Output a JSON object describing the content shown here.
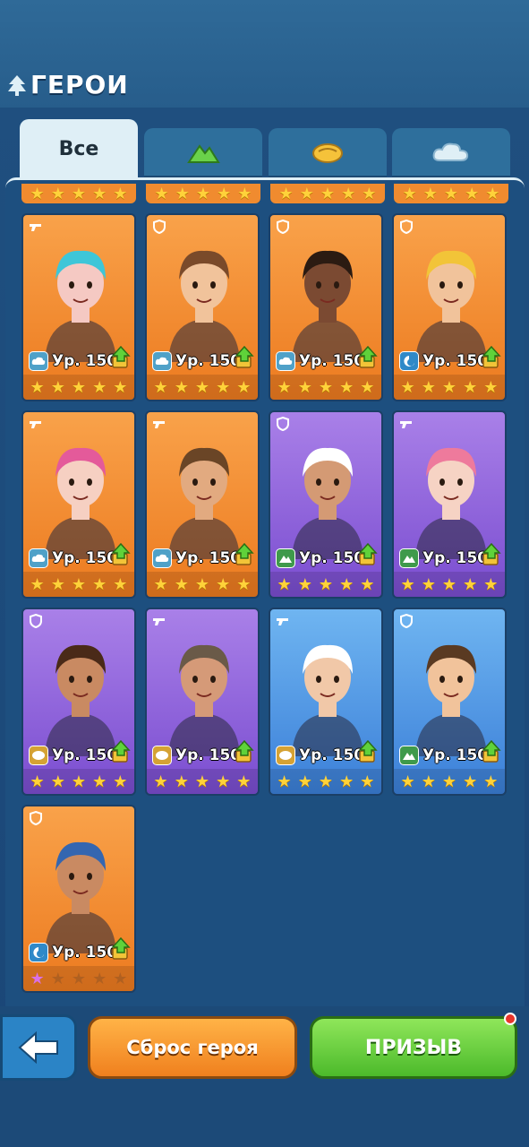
{
  "header": {
    "title": "ГЕРОИ"
  },
  "tabs": [
    {
      "label": "Все",
      "icon": "none",
      "active": true
    },
    {
      "label": "",
      "icon": "mountain-icon",
      "active": false
    },
    {
      "label": "",
      "icon": "fist-icon",
      "active": false
    },
    {
      "label": "",
      "icon": "cloud-icon",
      "active": false
    }
  ],
  "level_label": "Ур. 150",
  "heroes": [
    {
      "name": "jinx-hero",
      "bg": "orange",
      "element": "cloud",
      "role": "gun",
      "level": "Ур. 150",
      "stars": 5,
      "hair": "#3ec6d8",
      "skin": "#f5c9c3"
    },
    {
      "name": "headphone-hero",
      "bg": "orange",
      "element": "cloud",
      "role": "shield",
      "level": "Ур. 150",
      "stars": 5,
      "hair": "#7a4a2a",
      "skin": "#f1c39b"
    },
    {
      "name": "goggles-hero",
      "bg": "orange",
      "element": "cloud",
      "role": "shield",
      "level": "Ур. 150",
      "stars": 5,
      "hair": "#2b1b12",
      "skin": "#7b4a32"
    },
    {
      "name": "shark-costume-hero",
      "bg": "orange",
      "element": "wave",
      "role": "shield",
      "level": "Ур. 150",
      "stars": 5,
      "hair": "#f2c438",
      "skin": "#f1c39b"
    },
    {
      "name": "pink-twintails-hero",
      "bg": "orange",
      "element": "cloud",
      "role": "gun",
      "level": "Ур. 150",
      "stars": 5,
      "hair": "#e45a9a",
      "skin": "#f6d0c2"
    },
    {
      "name": "cap-hero",
      "bg": "orange",
      "element": "cloud",
      "role": "gun",
      "level": "Ур. 150",
      "stars": 5,
      "hair": "#6a4526",
      "skin": "#e2aa80"
    },
    {
      "name": "chef-hero",
      "bg": "purple",
      "element": "mountain",
      "role": "shield",
      "level": "Ур. 150",
      "stars": 5,
      "hair": "#ffffff",
      "skin": "#d49a74"
    },
    {
      "name": "pink-hair-girl-hero",
      "bg": "purple",
      "element": "mountain",
      "role": "gun",
      "level": "Ур. 150",
      "stars": 5,
      "hair": "#ee7a9c",
      "skin": "#f6d3c4"
    },
    {
      "name": "braided-girl-hero",
      "bg": "purple",
      "element": "fist",
      "role": "shield",
      "level": "Ур. 150",
      "stars": 5,
      "hair": "#4a2a18",
      "skin": "#c98a62"
    },
    {
      "name": "old-bearded-hero",
      "bg": "purple",
      "element": "fist",
      "role": "gun",
      "level": "Ур. 150",
      "stars": 5,
      "hair": "#6a5a48",
      "skin": "#d59a78"
    },
    {
      "name": "hooded-hero",
      "bg": "blue",
      "element": "fist",
      "role": "gun",
      "level": "Ур. 150",
      "stars": 5,
      "hair": "#ffffff",
      "skin": "#f1c8a8"
    },
    {
      "name": "angry-boy-hero",
      "bg": "blue",
      "element": "mountain",
      "role": "shield",
      "level": "Ур. 150",
      "stars": 5,
      "hair": "#5a3a22",
      "skin": "#f1c39b"
    },
    {
      "name": "captain-hero",
      "bg": "orange",
      "element": "wave",
      "role": "shield",
      "level": "Ур. 150",
      "stars": 1,
      "hair": "#3466b0",
      "skin": "#c98a62"
    }
  ],
  "buttons": {
    "back": "",
    "reset": "Сброс героя",
    "summon": "ПРИЗЫВ"
  },
  "colors": {
    "orange_card": "#f08b2f",
    "purple_card": "#8a5fdc",
    "blue_card": "#4f96e0",
    "summon": "#5cc535",
    "reset": "#f5942f"
  }
}
